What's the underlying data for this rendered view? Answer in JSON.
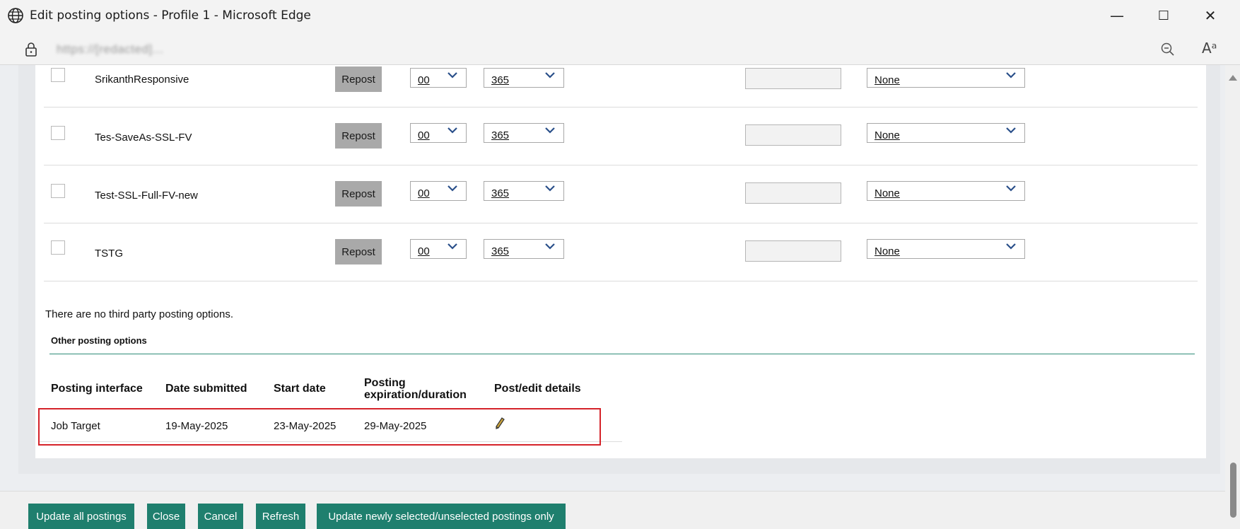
{
  "window": {
    "title": "Edit posting options - Profile 1 - Microsoft Edge",
    "minimize_label": "—",
    "maximize_label": "☐",
    "close_label": "✕"
  },
  "address_bar": {
    "url": "https://[redacted]...",
    "read_aloud_label": "Aᵃ"
  },
  "postings": [
    {
      "name": "SrikanthResponsive",
      "repost_label": "Repost",
      "select1": "00",
      "select2": "365",
      "select3": "None"
    },
    {
      "name": "Tes-SaveAs-SSL-FV",
      "repost_label": "Repost",
      "select1": "00",
      "select2": "365",
      "select3": "None"
    },
    {
      "name": "Test-SSL-Full-FV-new",
      "repost_label": "Repost",
      "select1": "00",
      "select2": "365",
      "select3": "None"
    },
    {
      "name": "TSTG",
      "repost_label": "Repost",
      "select1": "00",
      "select2": "365",
      "select3": "None"
    }
  ],
  "third_party_note": "There are no third party posting options.",
  "other_options": {
    "heading": "Other posting options",
    "columns": [
      "Posting interface",
      "Date submitted",
      "Start date",
      "Posting expiration/duration",
      "Post/edit details"
    ],
    "column_lines": {
      "expiration_line1": "Posting",
      "expiration_line2": "expiration/duration"
    },
    "row": {
      "interface": "Job Target",
      "date_submitted": "19-May-2025",
      "start_date": "23-May-2025",
      "expiration": "29-May-2025"
    }
  },
  "buttons": {
    "update_all": "Update all postings",
    "close": "Close",
    "cancel": "Cancel",
    "refresh": "Refresh",
    "update_newly": "Update newly selected/unselected postings only"
  },
  "colors": {
    "accent_green": "#1f7f6e",
    "highlight_red": "#d5232a"
  }
}
